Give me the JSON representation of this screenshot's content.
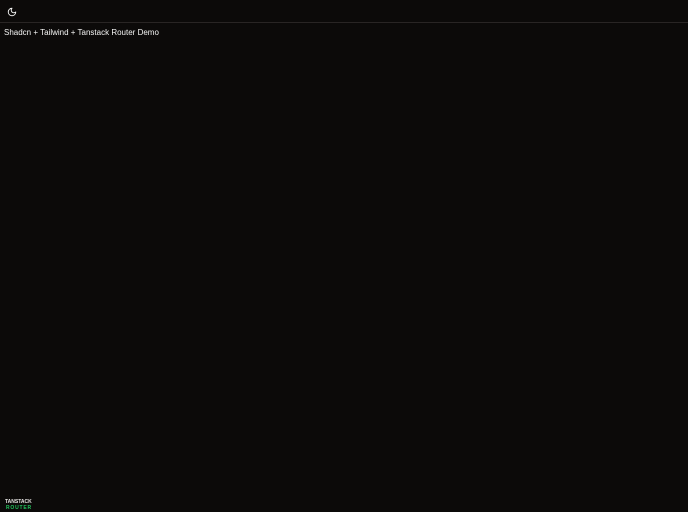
{
  "header": {
    "theme_toggle_icon": "moon-icon"
  },
  "main": {
    "title": "Shadcn + Tailwind + Tanstack Router Demo"
  },
  "devtools": {
    "line1": "TANSTACK",
    "line2": "ROUTER"
  },
  "colors": {
    "background": "#0c0a09",
    "border": "#292524",
    "text": "#f5f5f4",
    "router_green": "#22c55e"
  }
}
